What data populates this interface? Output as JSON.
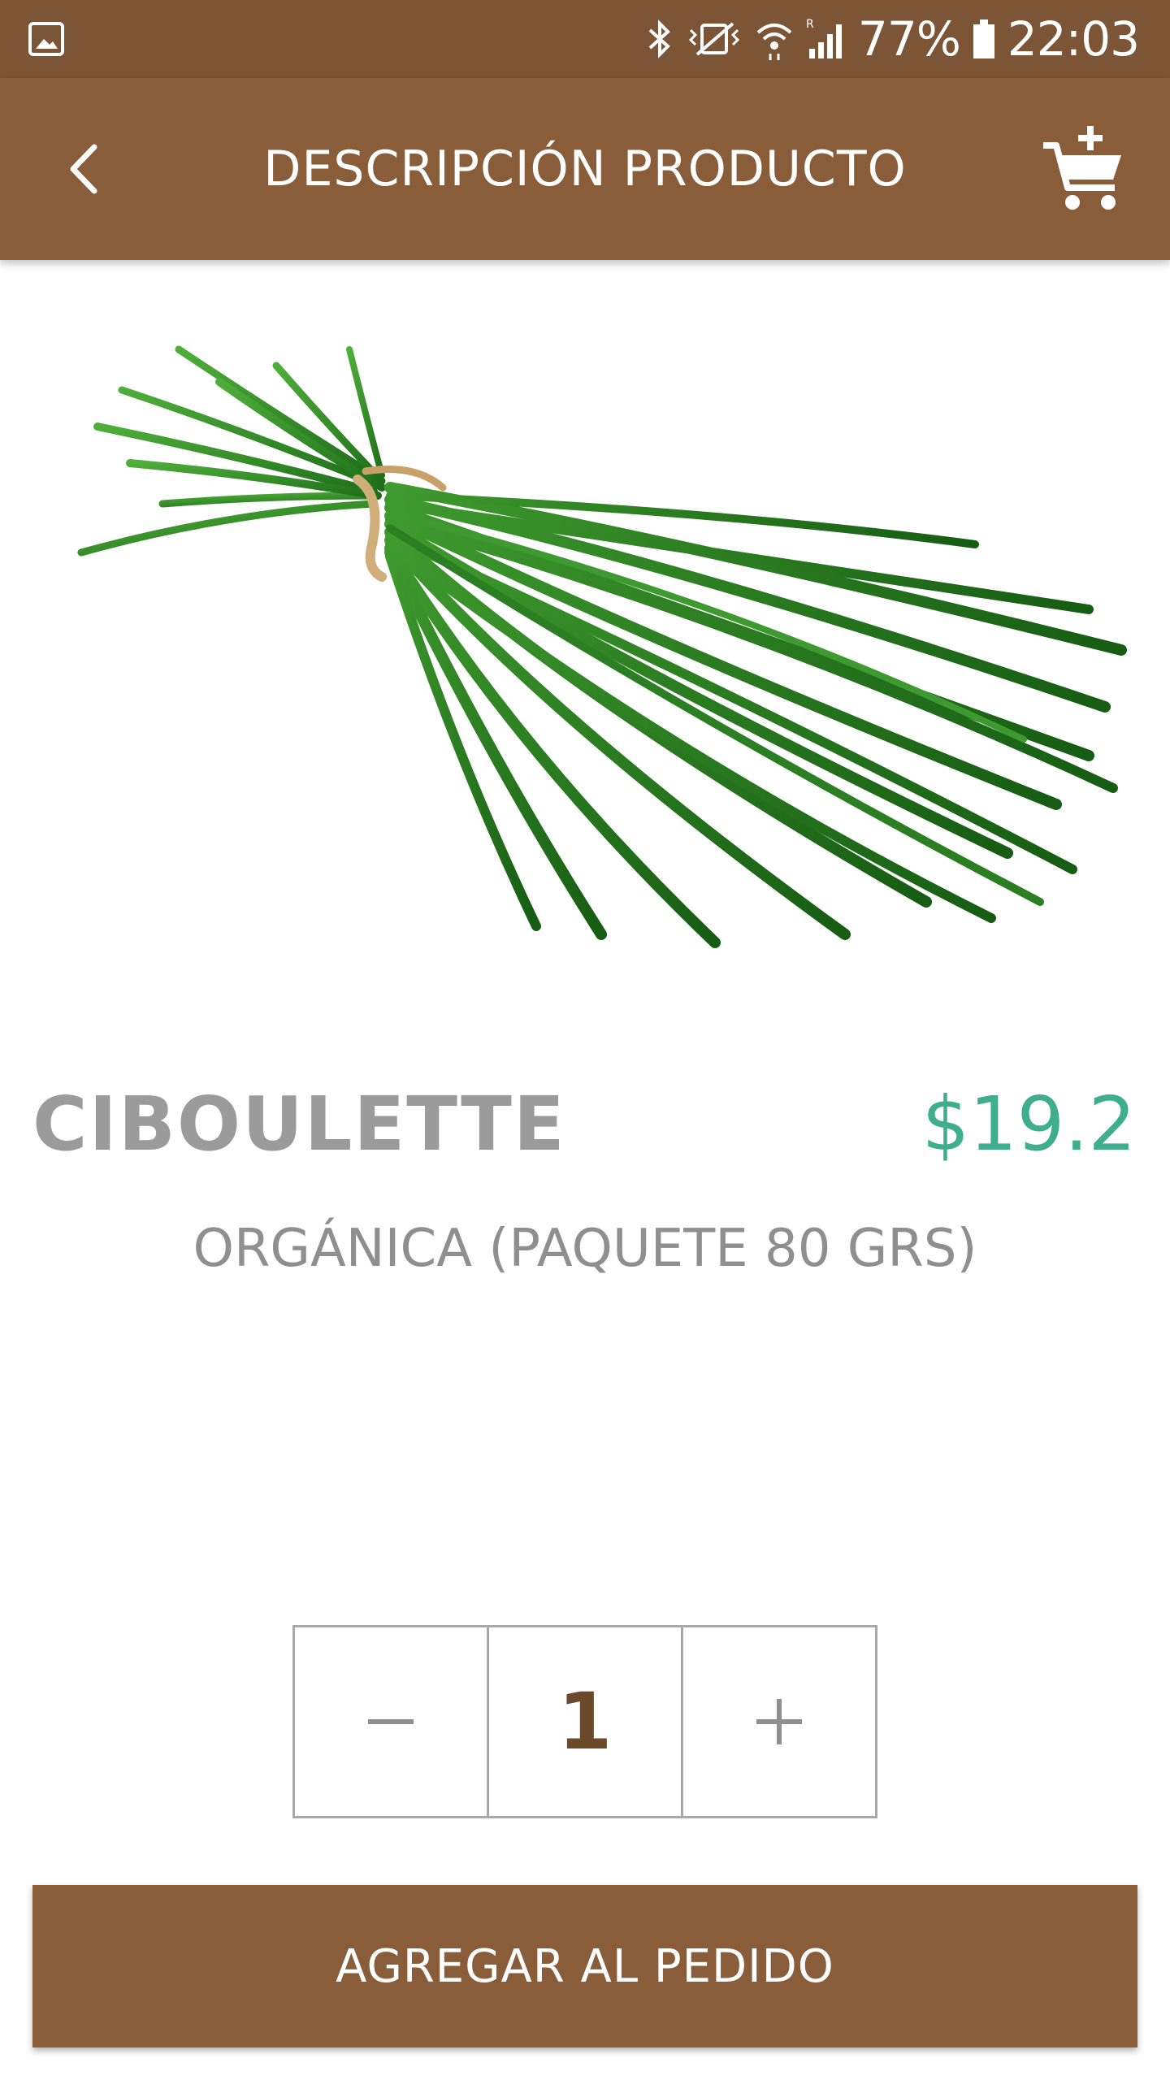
{
  "status_bar": {
    "battery": "77%",
    "time": "22:03",
    "icons": [
      "gallery-icon",
      "bluetooth-icon",
      "vibrate-icon",
      "wifi-icon",
      "signal-icon",
      "battery-icon"
    ]
  },
  "app_bar": {
    "title": "DESCRIPCIÓN PRODUCTO",
    "back_icon": "back-arrow-icon",
    "cart_icon": "add-to-cart-icon"
  },
  "product": {
    "name": "CIBOULETTE",
    "price": "$19.2",
    "description": "ORGÁNICA (PAQUETE 80 GRS)",
    "image": "chives-bundle-image"
  },
  "quantity": {
    "decrement": "−",
    "value": "1",
    "increment": "+"
  },
  "actions": {
    "add_label": "AGREGAR AL PEDIDO"
  },
  "colors": {
    "brand_brown": "#8a5d3a",
    "status_brown": "#7b5535",
    "price_green": "#3fae8c",
    "muted_gray": "#9b9b9b"
  }
}
